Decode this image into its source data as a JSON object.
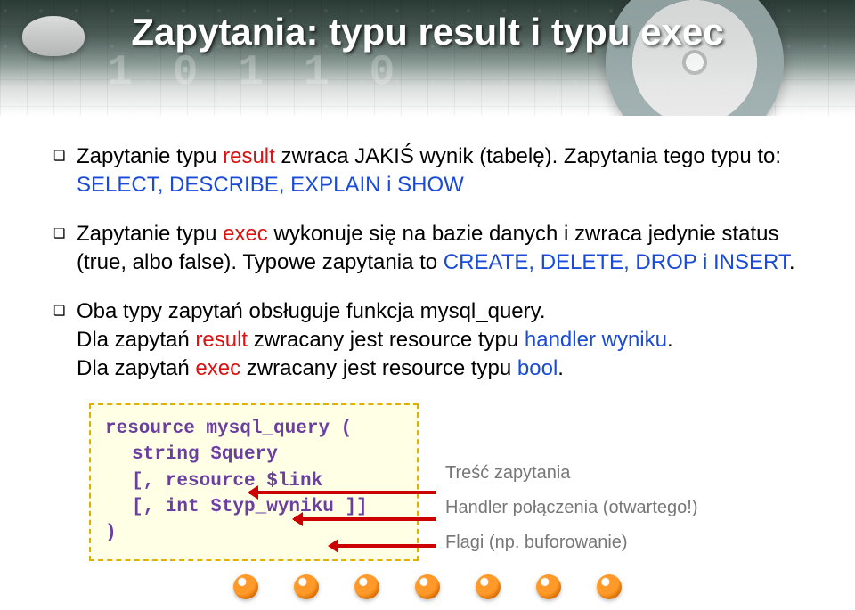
{
  "title": "Zapytania: typu result i typu exec",
  "bullets": {
    "b1": {
      "pre": "Zapytanie typu ",
      "kw": "result",
      "post": " zwraca JAKIŚ wynik (tabelę). Zapytania tego typu to: ",
      "types": "SELECT, DESCRIBE, EXPLAIN i SHOW"
    },
    "b2": {
      "pre": "Zapytanie typu ",
      "kw": "exec",
      "post": " wykonuje się na bazie danych i zwraca jedynie status (true, albo false). Typowe zapytania to ",
      "types": "CREATE, DELETE, DROP i INSERT",
      "end": "."
    },
    "b3": {
      "l1": "Oba typy zapytań obsługuje funkcja mysql_query.",
      "l2a": "Dla zapytań ",
      "l2kw": "result",
      "l2b": " zwracany jest resource  typu ",
      "l2c": "handler wyniku",
      "l2d": ".",
      "l3a": "Dla zapytań ",
      "l3kw": "exec",
      "l3b": " zwracany jest resource  typu ",
      "l3c": "bool",
      "l3d": "."
    }
  },
  "code": {
    "l1": "resource mysql_query (",
    "l2": "string $query",
    "l3": "[, resource $link",
    "l4": "[, int $typ_wyniku ]]",
    "l5": ")"
  },
  "annotations": {
    "a1": "Treść zapytania",
    "a2": "Handler połączenia (otwartego!)",
    "a3": "Flagi (np. buforowanie)"
  },
  "decor_digits": "1 0 1 1 0"
}
